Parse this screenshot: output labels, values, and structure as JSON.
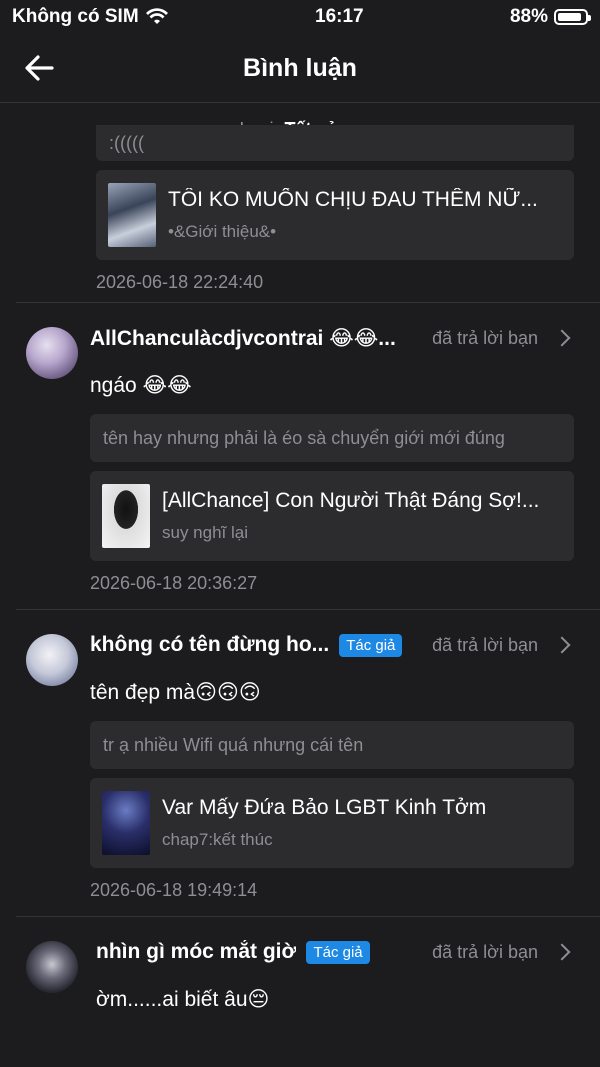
{
  "status": {
    "carrier": "Không có SIM",
    "time": "16:17",
    "battery": "88%",
    "battery_level": 0.88
  },
  "nav": {
    "title": "Bình luận"
  },
  "filter": {
    "label": "Loại:",
    "value": "Tất cả"
  },
  "top_partial": {
    "quote": ":(((((",
    "work_title": "TÔI KO MUỐN CHỊU ĐAU THÊM NỮ...",
    "work_sub": "•&Giới thiệu&•",
    "date": "2026-06-18 22:24:40"
  },
  "comments": [
    {
      "username": "AllChanculàcdjvcontrai 😂😂...",
      "replied": "đã trả lời bạn",
      "text": "ngáo 😂😂",
      "quote": "tên hay nhưng phải là éo sà chuyển giới mới đúng",
      "work_title": "[AllChance] Con Người Thật Đáng Sợ!...",
      "work_sub": "suy nghĩ lại",
      "date": "2026-06-18 20:36:27"
    },
    {
      "username": "không có tên đừng ho...",
      "badge": "Tác giả",
      "replied": "đã trả lời bạn",
      "text": "tên đẹp mà🙃🙃🙃",
      "quote": "tr ạ nhiều Wifi quá nhưng cái tên",
      "work_title": "Var Mấy Đứa Bảo LGBT Kinh Tởm",
      "work_sub": "chap7:kết thúc",
      "date": "2026-06-18 19:49:14"
    },
    {
      "username": "nhìn gì móc mắt giờ",
      "badge": "Tác giả",
      "replied": "đã trả lời bạn",
      "text": "ờm......ai biết âu😔"
    }
  ]
}
